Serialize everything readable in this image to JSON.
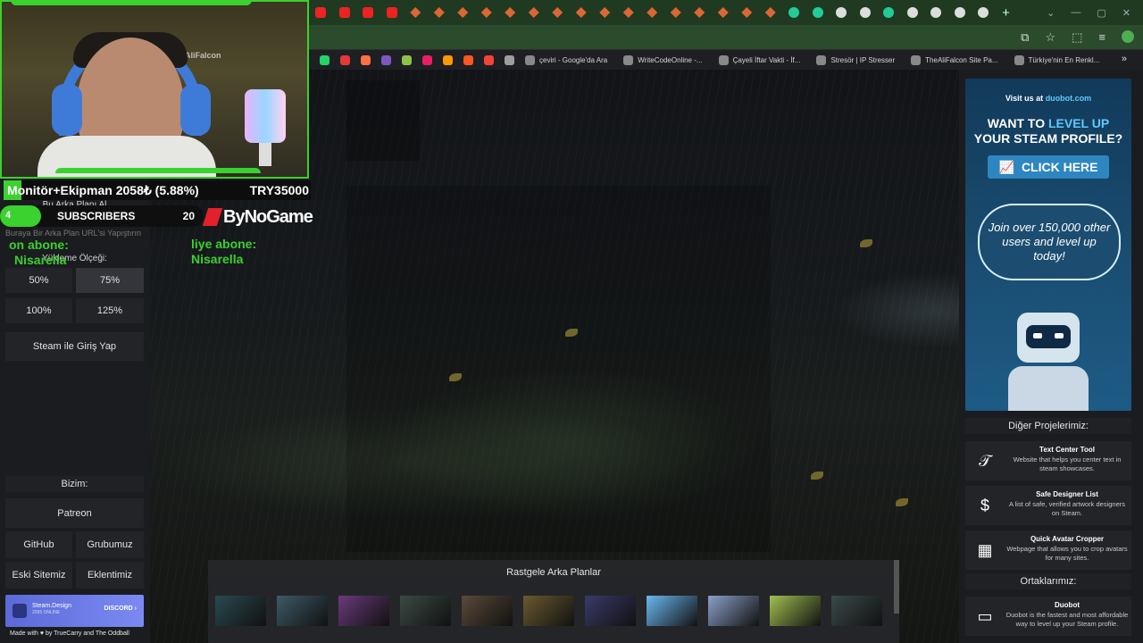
{
  "browser": {
    "tab_count_icons": [
      "yt",
      "yt",
      "yt",
      "yt",
      "fx",
      "fx",
      "fx",
      "fx",
      "fx",
      "fx",
      "fx",
      "fx",
      "fx",
      "fx",
      "fx",
      "fx",
      "fx",
      "fx",
      "fx",
      "fx",
      "g",
      "g",
      "w",
      "w",
      "g",
      "w",
      "w",
      "w",
      "w"
    ],
    "new_tab_label": "+",
    "window_controls": [
      "⌄",
      "—",
      "▢",
      "✕"
    ],
    "toolbar_icons": [
      "⧉",
      "☆",
      "⬚",
      "≡"
    ],
    "bookmarks": [
      {
        "label": "çeviri - Google'da Ara"
      },
      {
        "label": "WriteCodeOnline -..."
      },
      {
        "label": "Çayeli İftar Vakti - İf..."
      },
      {
        "label": "Stresör | IP Stresser"
      },
      {
        "label": "TheAliFalcon Site Pa..."
      },
      {
        "label": "Türkiye'nin En Renkl..."
      }
    ],
    "bookmarks_more": "»"
  },
  "sidebar": {
    "bg_label": "Bu Arka Planı Al",
    "url_placeholder": "Buraya Bir Arka Plan URL'si Yapıştırın",
    "scale_label": "Yükleme Ölçeği:",
    "scales": [
      "50%",
      "75%",
      "100%",
      "125%"
    ],
    "active_scale": "75%",
    "steam_login": "Steam ile Giriş Yap",
    "bizim_label": "Bizim:",
    "patreon": "Patreon",
    "github": "GitHub",
    "grubumuz": "Grubumuz",
    "eski_sitemiz": "Eski Sitemiz",
    "eklentimiz": "Eklentimiz",
    "discord_banner": {
      "name": "Steam.Design",
      "sub": "2095 ONLINE",
      "cta": "DISCORD ›"
    },
    "made_with": "Made with ♥ by TrueCarry and The Oddball"
  },
  "promo": {
    "visit_prefix": "Visit us at",
    "visit_site": "duobot.com",
    "want_prefix": "WANT TO",
    "want_level": "LEVEL UP",
    "want_suffix": "YOUR STEAM PROFILE?",
    "cta": "CLICK HERE",
    "bubble": "Join over 150,000 other users and level up today!",
    "robot_badge": "OOO"
  },
  "projects": {
    "header": "Diğer Projelerimiz:",
    "items": [
      {
        "title": "Text Center Tool",
        "desc": "Website that helps you center text in steam showcases.",
        "icon": "𝒯"
      },
      {
        "title": "Safe Designer List",
        "desc": "A list of safe, verified artwork designers on Steam.",
        "icon": "$"
      },
      {
        "title": "Quick Avatar Cropper",
        "desc": "Webpage that allows you to crop avatars for many sites.",
        "icon": "▦"
      }
    ],
    "partners_header": "Ortaklarımız:",
    "partner": {
      "title": "Duobot",
      "desc": "Duobot is the fastest and most affordable way to level up your Steam profile.",
      "icon": "▭"
    }
  },
  "random": {
    "title": "Rastgele Arka Planlar",
    "thumb_colors": [
      "#2a4a4f",
      "#3d5a66",
      "#6a3a7a",
      "#3b4a45",
      "#5a4a3a",
      "#6a5a30",
      "#3a3a6a",
      "#6ab8f0",
      "#8aa0c8",
      "#a0c050",
      "#3a4a4a"
    ]
  },
  "stream": {
    "goal_name": "Monitör+Ekipman 2058₺ (5.88%)",
    "goal_target": "TRY35000",
    "goal_progress": 0.0588,
    "subs_current": "4",
    "subs_label": "SUBSCRIBERS",
    "subs_target": "20",
    "subs_progress": 0.2,
    "brand": "ByNoGame",
    "alert_left_1": "on abone:",
    "alert_left_2": "Nisarella",
    "alert_right_1": "liye abone:",
    "alert_right_2": "Nisarella",
    "wall_text": "eAliFalcon"
  },
  "colors": {
    "accent_green": "#3bd12f",
    "duobot_blue": "#5ec9ff"
  }
}
